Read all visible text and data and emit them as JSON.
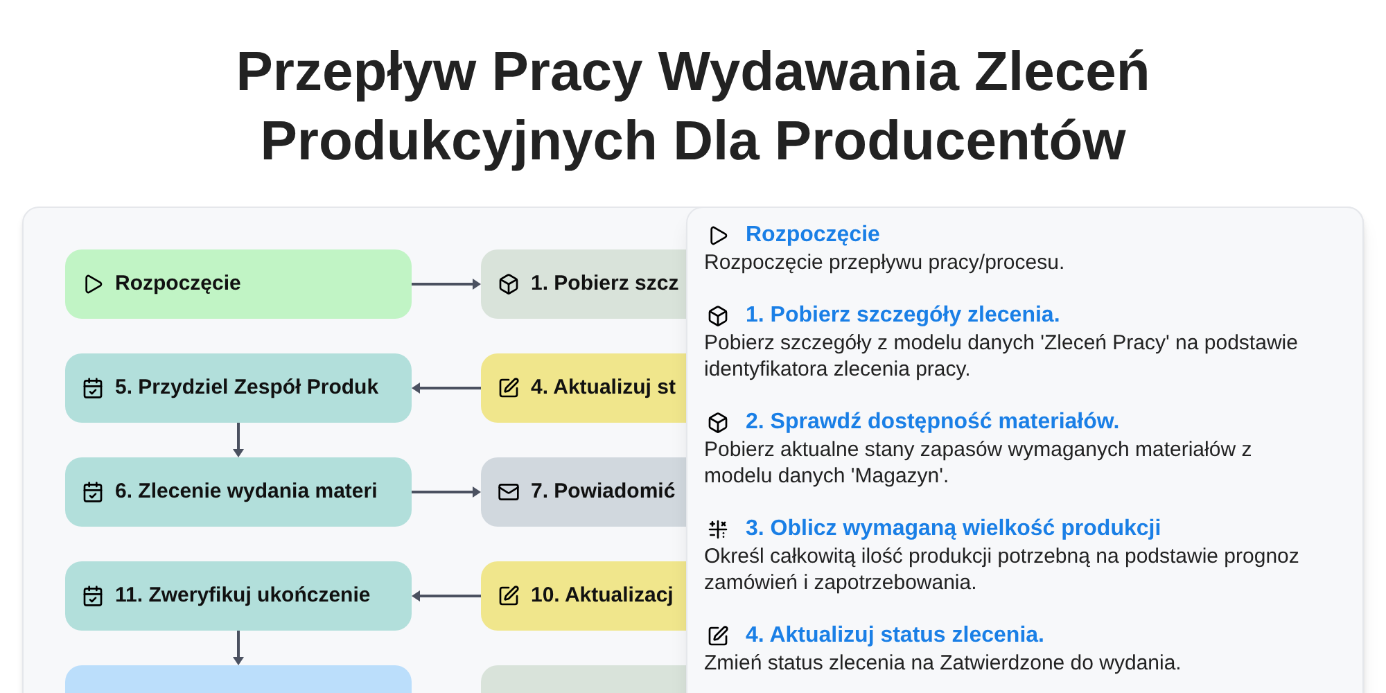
{
  "title": "Przepływ Pracy Wydawania Zleceń Produkcyjnych Dla Producentów",
  "flow_rows": [
    {
      "left": {
        "kind": "start",
        "label": "Rozpoczęcie",
        "color": "#c1f4c5"
      },
      "arrow_back": false,
      "right": {
        "kind": "fetch",
        "label": "1. Pobierz szcz",
        "color": "#d9e3da"
      },
      "down_arrow": false
    },
    {
      "left": {
        "kind": "task",
        "label": "5. Przydziel Zespół Produk",
        "color": "#b2dfdb"
      },
      "arrow_back": true,
      "right": {
        "kind": "update",
        "label": "4. Aktualizuj st",
        "color": "#f0e68c"
      },
      "down_arrow": true
    },
    {
      "left": {
        "kind": "task",
        "label": "6. Zlecenie wydania materi",
        "color": "#b2dfdb"
      },
      "arrow_back": false,
      "right": {
        "kind": "notify",
        "label": "7. Powiadomić",
        "color": "#d1d8de"
      },
      "down_arrow": false
    },
    {
      "left": {
        "kind": "task",
        "label": "11. Zweryfikuj ukończenie",
        "color": "#b2dfdb"
      },
      "arrow_back": true,
      "right": {
        "kind": "update",
        "label": "10. Aktualizacj",
        "color": "#f0e68c"
      },
      "down_arrow": true
    },
    {
      "left": {
        "kind": "blank",
        "color": "#bbdefb"
      },
      "right": {
        "kind": "blank",
        "color": "#d9e3da"
      }
    }
  ],
  "details": [
    {
      "kind": "start",
      "title": "Rozpoczęcie",
      "description": "Rozpoczęcie przepływu pracy/procesu."
    },
    {
      "kind": "fetch",
      "title": "1. Pobierz szczegóły zlecenia.",
      "description": "Pobierz szczegóły z modelu danych 'Zleceń Pracy' na podstawie identyfikatora zlecenia pracy."
    },
    {
      "kind": "fetch",
      "title": "2. Sprawdź dostępność materiałów.",
      "description": "Pobierz aktualne stany zapasów wymaganych materiałów z modelu danych 'Magazyn'."
    },
    {
      "kind": "calculate",
      "title": "3. Oblicz wymaganą wielkość produkcji",
      "description": "Określ całkowitą ilość produkcji potrzebną na podstawie prognoz zamówień i zapotrzebowania."
    },
    {
      "kind": "update",
      "title": "4. Aktualizuj status zlecenia.",
      "description": "Zmień status zlecenia na Zatwierdzone do wydania."
    }
  ]
}
